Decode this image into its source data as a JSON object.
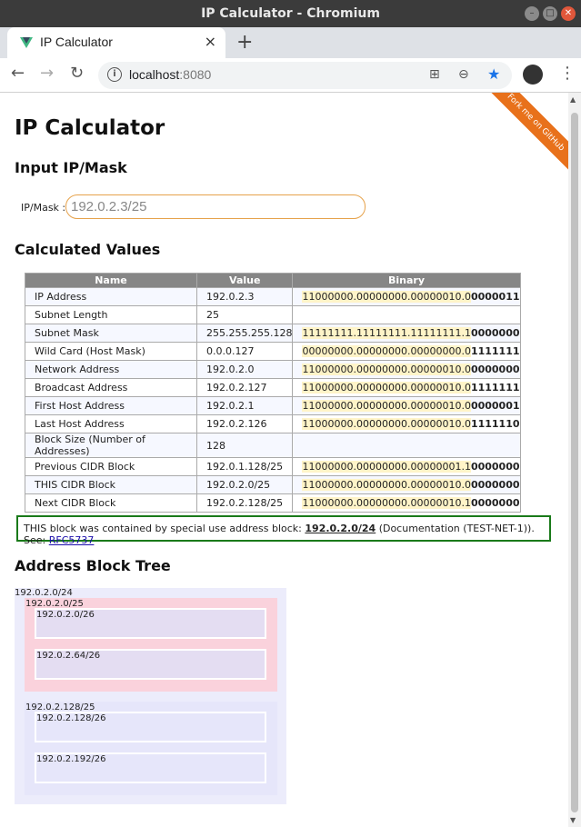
{
  "window": {
    "title": "IP Calculator - Chromium"
  },
  "tab": {
    "label": "IP Calculator",
    "close": "×",
    "new_tab": "+"
  },
  "omnibox": {
    "host": "localhost",
    "port": ":8080"
  },
  "ribbon": {
    "text": "Fork me on GitHub"
  },
  "page": {
    "title": "IP Calculator",
    "input_heading": "Input IP/Mask",
    "mask_label": "IP/Mask :",
    "mask_value": "192.0.2.3/25",
    "calc_heading": "Calculated Values",
    "tree_heading": "Address Block Tree"
  },
  "table": {
    "headers": [
      "Name",
      "Value",
      "Binary"
    ],
    "rows": [
      {
        "name": "IP Address",
        "value": "192.0.2.3",
        "bin_net": "11000000.00000000.00000010.0",
        "bin_host": "0000011"
      },
      {
        "name": "Subnet Length",
        "value": "25",
        "bin_net": "",
        "bin_host": ""
      },
      {
        "name": "Subnet Mask",
        "value": "255.255.255.128",
        "bin_net": "11111111.11111111.11111111.1",
        "bin_host": "0000000"
      },
      {
        "name": "Wild Card (Host Mask)",
        "value": "0.0.0.127",
        "bin_net": "00000000.00000000.00000000.0",
        "bin_host": "1111111"
      },
      {
        "name": "Network Address",
        "value": "192.0.2.0",
        "bin_net": "11000000.00000000.00000010.0",
        "bin_host": "0000000"
      },
      {
        "name": "Broadcast Address",
        "value": "192.0.2.127",
        "bin_net": "11000000.00000000.00000010.0",
        "bin_host": "1111111"
      },
      {
        "name": "First Host Address",
        "value": "192.0.2.1",
        "bin_net": "11000000.00000000.00000010.0",
        "bin_host": "0000001"
      },
      {
        "name": "Last Host Address",
        "value": "192.0.2.126",
        "bin_net": "11000000.00000000.00000010.0",
        "bin_host": "1111110"
      },
      {
        "name": "Block Size (Number of Addresses)",
        "value": "128",
        "bin_net": "",
        "bin_host": ""
      },
      {
        "name": "Previous CIDR Block",
        "value": "192.0.1.128/25",
        "bin_net": "11000000.00000000.00000001.1",
        "bin_host": "0000000"
      },
      {
        "name": "THIS CIDR Block",
        "value": "192.0.2.0/25",
        "bin_net": "11000000.00000000.00000010.0",
        "bin_host": "0000000"
      },
      {
        "name": "Next CIDR Block",
        "value": "192.0.2.128/25",
        "bin_net": "11000000.00000000.00000010.1",
        "bin_host": "0000000"
      }
    ]
  },
  "notice": {
    "prefix": "THIS block was contained by special use address block:",
    "block": "192.0.2.0/24",
    "middle": "(Documentation (TEST-NET-1)). See:",
    "link": "RFC5737"
  },
  "tree": {
    "root": "192.0.2.0/24",
    "children": [
      {
        "label": "192.0.2.0/25",
        "leaves": [
          "192.0.2.0/26",
          "192.0.2.64/26"
        ]
      },
      {
        "label": "192.0.2.128/25",
        "leaves": [
          "192.0.2.128/26",
          "192.0.2.192/26"
        ]
      }
    ]
  },
  "colors": {
    "ribbon": "#e8711b",
    "input_border": "#e6a24b",
    "notice_border": "#1a7a1a",
    "table_header": "#868686"
  }
}
